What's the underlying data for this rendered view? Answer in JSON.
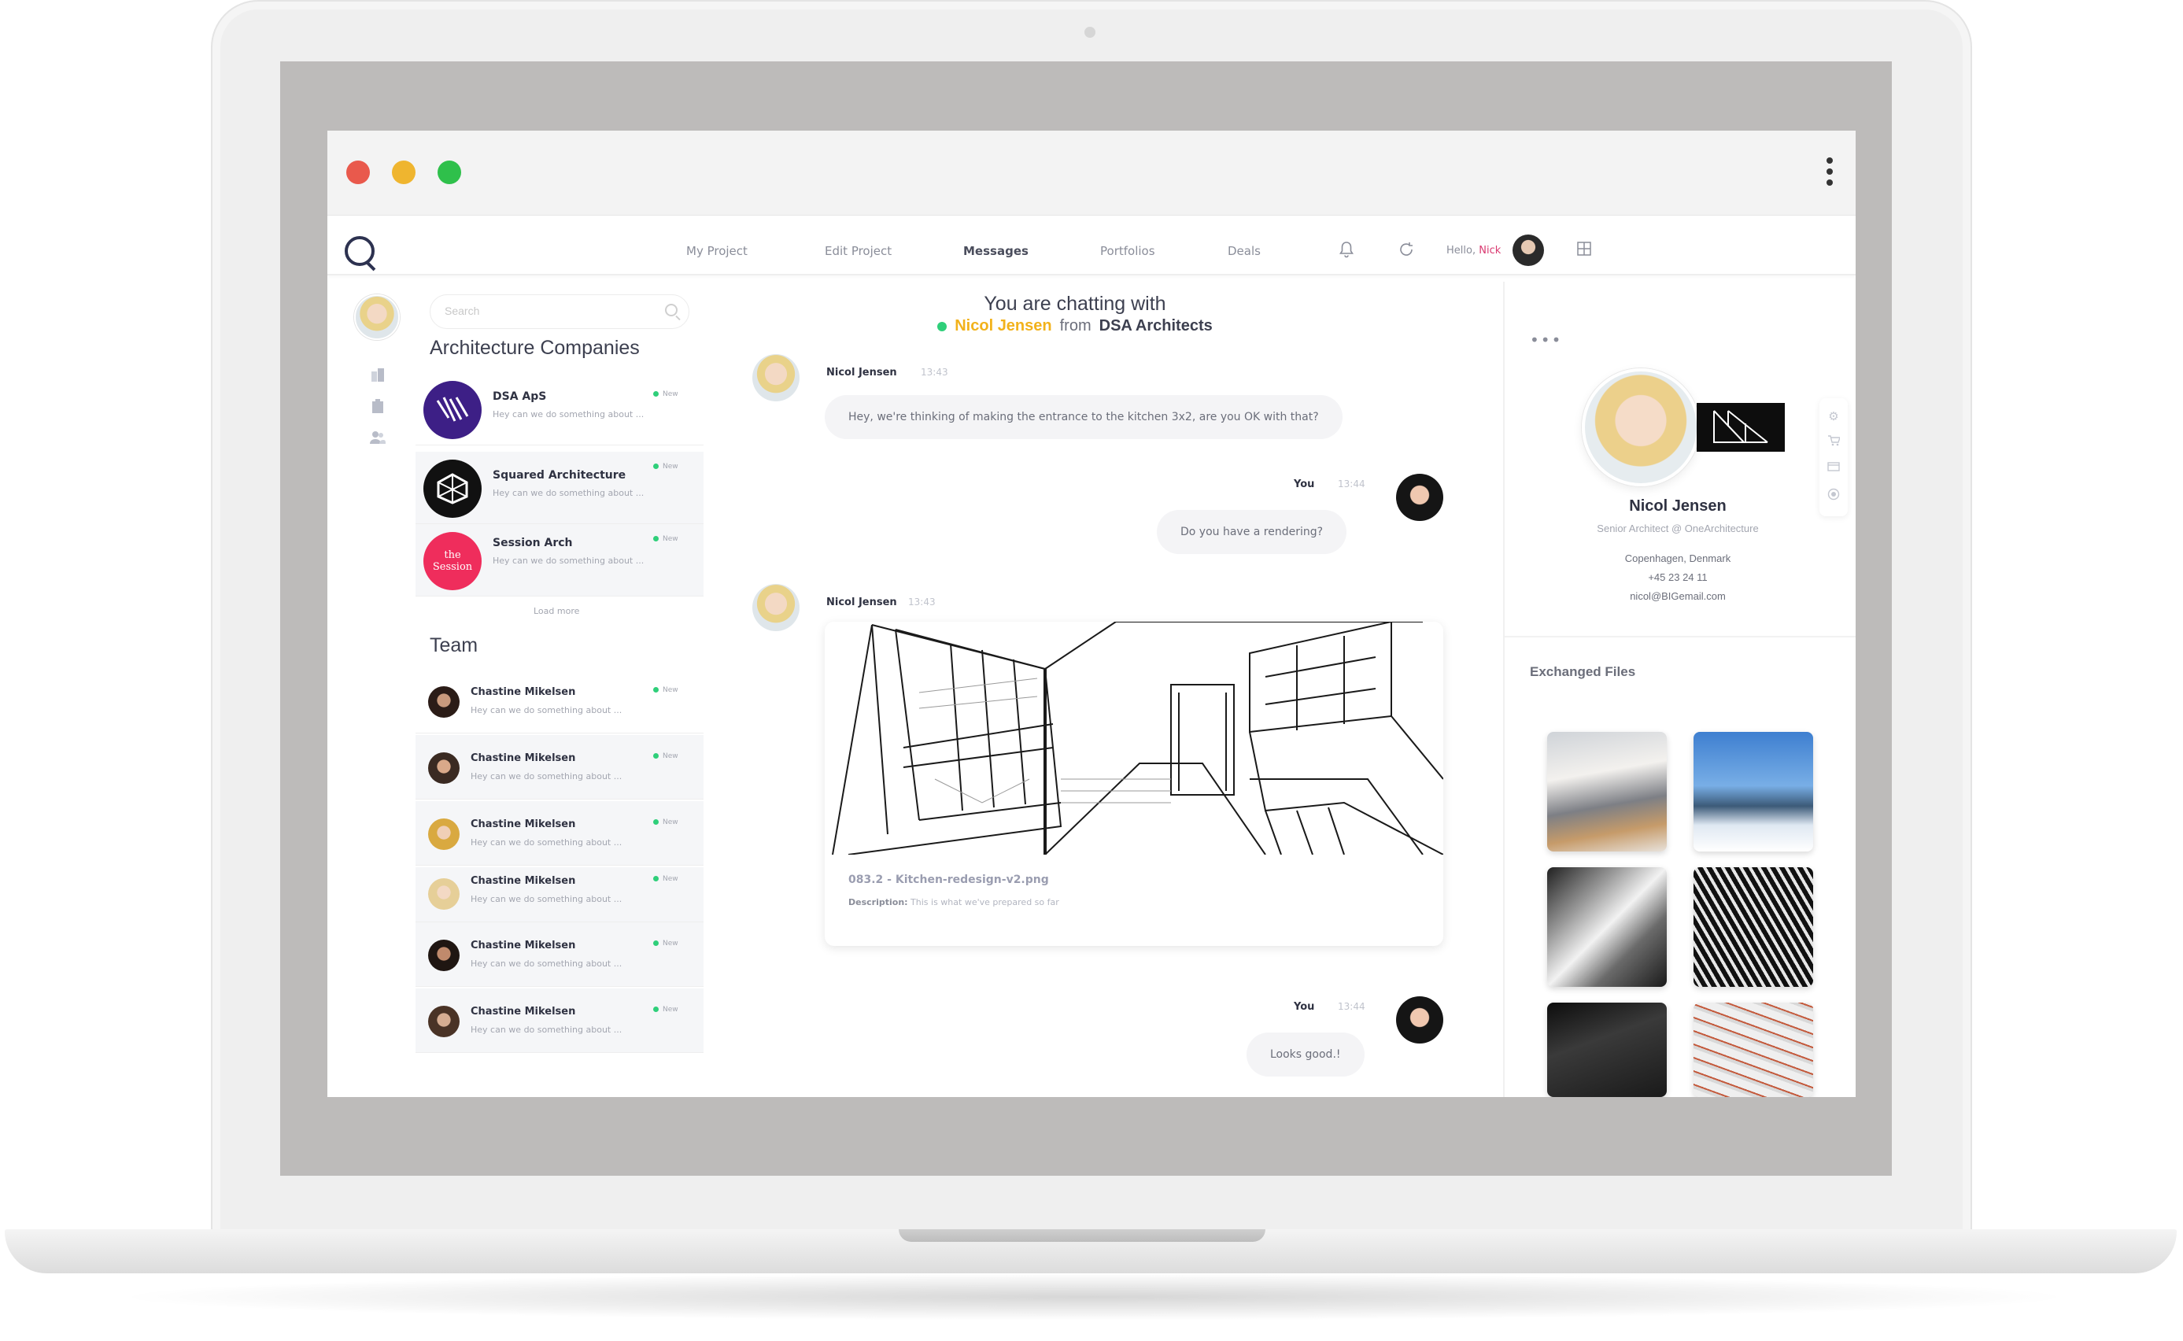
{
  "nav": {
    "items": [
      "My Project",
      "Edit Project",
      "Messages",
      "Portfolios",
      "Deals"
    ],
    "active": "Messages",
    "greeting": "Hello,",
    "user": "Nick"
  },
  "search": {
    "placeholder": "Search"
  },
  "companies": {
    "title": "Architecture Companies",
    "items": [
      {
        "name": "DSA ApS",
        "snippet": "Hey can we do something about ...",
        "badge": "New",
        "logo_text": "",
        "color": "#3d1f86"
      },
      {
        "name": "Squared Architecture",
        "snippet": "Hey can we do something about ...",
        "badge": "New",
        "logo_text": "",
        "color": "#111111"
      },
      {
        "name": "Session Arch",
        "snippet": "Hey can we do something about ...",
        "badge": "New",
        "logo_text": "the Session",
        "color": "#ef2d5c"
      }
    ],
    "load_more": "Load more"
  },
  "team": {
    "title": "Team",
    "items": [
      {
        "name": "Chastine Mikelsen",
        "snippet": "Hey can we do something about ...",
        "badge": "New"
      },
      {
        "name": "Chastine Mikelsen",
        "snippet": "Hey can we do something about ...",
        "badge": "New"
      },
      {
        "name": "Chastine Mikelsen",
        "snippet": "Hey can we do something about ...",
        "badge": "New"
      },
      {
        "name": "Chastine Mikelsen",
        "snippet": "Hey can we do something about ...",
        "badge": "New"
      },
      {
        "name": "Chastine Mikelsen",
        "snippet": "Hey can we do something about ...",
        "badge": "New"
      },
      {
        "name": "Chastine Mikelsen",
        "snippet": "Hey can we do something about ...",
        "badge": "New"
      }
    ]
  },
  "chat": {
    "header_line1": "You are chatting with",
    "contact": "Nicol Jensen",
    "from": "from",
    "company": "DSA Architects",
    "messages": [
      {
        "author": "Nicol Jensen",
        "time": "13:43",
        "text": "Hey, we're thinking of making the entrance to the kitchen 3x2, are you OK with that?"
      },
      {
        "author": "You",
        "time": "13:44",
        "text": "Do you have a rendering?"
      },
      {
        "author": "Nicol Jensen",
        "time": "13:43",
        "file_name": "083.2 - Kitchen-redesign-v2.png",
        "desc_label": "Description:",
        "desc_text": "This is what we've prepared so far"
      },
      {
        "author": "You",
        "time": "13:44",
        "text": "Looks good.!"
      }
    ]
  },
  "profile": {
    "name": "Nicol Jensen",
    "title": "Senior Architect @ OneArchitecture",
    "location": "Copenhagen, Denmark",
    "phone": "+45 23 24 11",
    "email": "nicol@BIGemail.com",
    "files_title": "Exchanged Files"
  },
  "colors": {
    "accent_pink": "#d93970",
    "accent_yellow": "#f2b21b",
    "online_green": "#2fcf7a",
    "text_dark": "#2f3242"
  }
}
